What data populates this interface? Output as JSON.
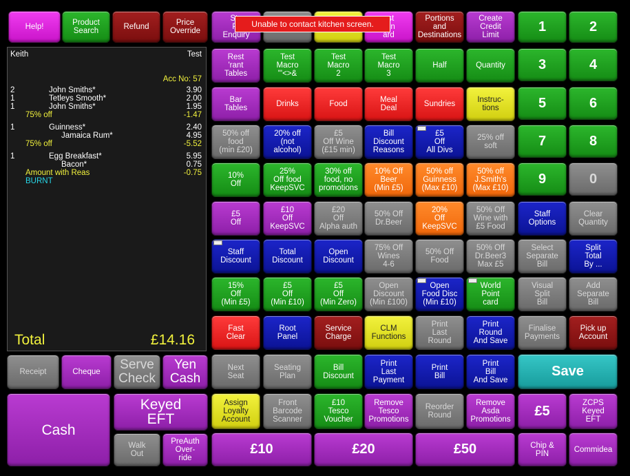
{
  "alert": "Unable to contact kitchen screen.",
  "order": {
    "customer": "Keith",
    "tag": "Test",
    "account": "Acc No: 57",
    "lines": [
      {
        "qty": "2",
        "name": "John Smiths*",
        "price": "3.90",
        "style": ""
      },
      {
        "qty": "1",
        "name": "Tetleys Smooth*",
        "price": "2.00",
        "style": ""
      },
      {
        "qty": "1",
        "name": "John Smiths*",
        "price": "1.95",
        "style": ""
      },
      {
        "qty": "",
        "name": "75% off",
        "price": "-1.47",
        "style": "yel"
      },
      {
        "qty": "1",
        "name": "Guinness*",
        "price": "2.40",
        "style": ""
      },
      {
        "qty": "",
        "name": "Jamaica Rum*",
        "price": "4.95",
        "style": "indent"
      },
      {
        "qty": "",
        "name": "75% off",
        "price": "-5.52",
        "style": "yel"
      },
      {
        "qty": "1",
        "name": "Egg Breakfast*",
        "price": "5.95",
        "style": ""
      },
      {
        "qty": "",
        "name": "Bacon*",
        "price": "0.75",
        "style": "indent"
      },
      {
        "qty": "",
        "name": "Amount with Reas",
        "price": "-0.75",
        "style": "yel2"
      },
      {
        "qty": "",
        "name": "BURNT",
        "price": "",
        "style": "cyan"
      }
    ],
    "total_label": "Total",
    "total_value": "£14.16"
  },
  "buttons": {
    "help": "Help!",
    "product_search": "Product\nSearch",
    "refund": "Refund",
    "price_override": "Price\nOverride",
    "stock_enquiry": "Sto\nPr\nEnquiry",
    "hidden2": "",
    "hidden3": "",
    "hidden4": "est\ntion\nard",
    "portions": "Portions\nand\nDestinations",
    "credit_limit": "Create\nCredit\nLimit",
    "num1": "1",
    "num2": "2",
    "num3": "3",
    "num4": "4",
    "num5": "5",
    "num6": "6",
    "num7": "7",
    "num8": "8",
    "num9": "9",
    "num0": "0",
    "rest_tables": "Rest\n'rant\nTables",
    "macro1": "Test\nMacro\n\"'<>&",
    "macro2": "Test\nMacro\n2",
    "macro3": "Test\nMacro\n3",
    "half": "Half",
    "quantity": "Quantity",
    "bar_tables": "Bar\nTables",
    "drinks": "Drinks",
    "food": "Food",
    "meal_deal": "Meal\nDeal",
    "sundries": "Sundries",
    "instructions": "Instruc-\ntions",
    "d50food": "50% off\nfood\n(min £20)",
    "d20alc": "20% off\n(not\nalcohol)",
    "d5wine": "£5\nOff Wine\n(£15 min)",
    "bill_discount_reasons": "Bill\nDiscount\nReasons",
    "d5alldivs": "£5\nOff\nAll Divs",
    "d25soft": "25% off\nsoft",
    "d10": "10%\nOff",
    "d25food": "25%\nOff food\nKeepSVC",
    "d30food": "30% off\nfood, no\npromotions",
    "d10beer": "10% Off\nBeer\n(Min £5)",
    "d50guin": "50% off\nGuinness\n(Max £10)",
    "d50js": "50% off\nJ.Smith's\n(Max £10)",
    "d5off": "£5\nOff",
    "d10keep": "£10\nOff\nKeepSVC",
    "d20alpha": "£20\nOff\nAlpha auth",
    "d50drbeer": "50% Off\nDr.Beer",
    "d20keep": "20%\nOff\nKeepSVC",
    "d50wine": "50% Off\nWine with\n£5 Food",
    "staff_options": "Staff\nOptions",
    "clear_quantity": "Clear\nQuantity",
    "staff_discount": "Staff\nDiscount",
    "total_discount": "Total\nDiscount",
    "open_discount": "Open\nDiscount",
    "d75wines": "75% Off\nWines\n4-6",
    "d50food2": "50% Off\nFood",
    "d50drbeer3": "50% Off\nDr.Beer3\nMax £5",
    "select_separate": "Select\nSeparate\nBill",
    "split_total": "Split\nTotal\nBy ...",
    "d15": "15%\nOff\n(Min £5)",
    "d5min10": "£5\nOff\n(Min £10)",
    "d5minzero": "£5\nOff\n(Min Zero)",
    "open_disc100": "Open\nDiscount\n(Min £100)",
    "open_food_disc": "Open\nFood Disc\n(Min £10)",
    "world_point": "World\nPoint\ncard",
    "visual_split": "Visual\nSplit\nBill",
    "add_separate": "Add\nSeparate\nBill",
    "fast_clear": "Fast\nClear",
    "root_panel": "Root\nPanel",
    "service_charge": "Service\nCharge",
    "clm_functions": "CLM\nFunctions",
    "print_last_round": "Print\nLast\nRound",
    "print_round_save": "Print\nRound\nAnd Save",
    "finalise_payments": "Finalise\nPayments",
    "pickup_account": "Pick up\nAccount",
    "receipt": "Receipt",
    "cheque": "Cheque",
    "serve_check": "Serve\nCheck",
    "yen_cash": "Yen\nCash",
    "next_seat": "Next\nSeat",
    "seating_plan": "Seating\nPlan",
    "bill_discount": "Bill\nDiscount",
    "print_last_payment": "Print\nLast\nPayment",
    "print_bill": "Print\nBill",
    "print_bill_save": "Print\nBill\nAnd Save",
    "save": "Save",
    "cash": "Cash",
    "keyed_eft": "Keyed\nEFT",
    "walk_out": "Walk\nOut",
    "preauth": "PreAuth\nOver-\nride",
    "assign_loyalty": "Assign\nLoyalty\nAccount",
    "front_barcode": "Front\nBarcode\nScanner",
    "tesco_voucher": "£10\nTesco\nVoucher",
    "remove_tesco": "Remove\nTesco\nPromotions",
    "reorder_round": "Reorder\nRound",
    "remove_asda": "Remove\nAsda\nPromotions",
    "p5": "£5",
    "zcps": "ZCPS\nKeyed\nEFT",
    "p10": "£10",
    "p20": "£20",
    "p50": "£50",
    "chip_pin": "Chip &\nPIN",
    "commidea": "Commidea"
  }
}
